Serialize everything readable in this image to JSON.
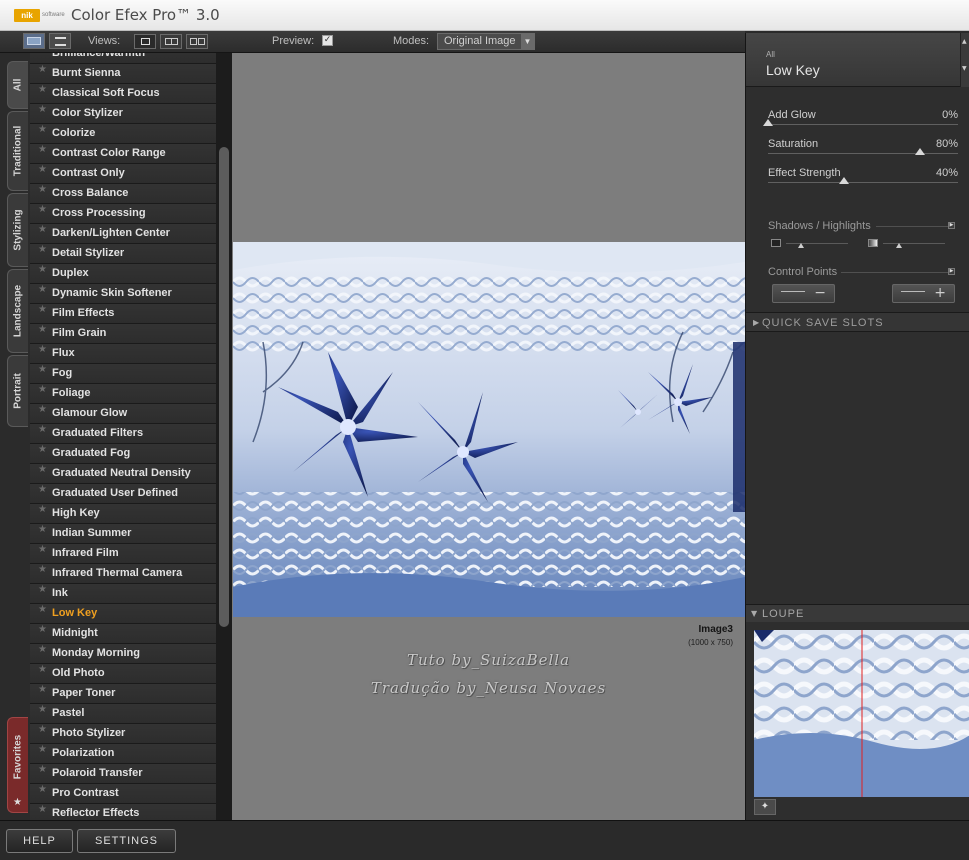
{
  "window": {
    "title": "Color Efex Pro™ 3.0",
    "logo_badge": "nik",
    "logo_sub": "software"
  },
  "toolbar": {
    "views_label": "Views:",
    "preview_label": "Preview:",
    "preview_checked": "✓",
    "modes_label": "Modes:",
    "mode_value": "Original Image"
  },
  "tabs": [
    {
      "label": "All"
    },
    {
      "label": "Traditional"
    },
    {
      "label": "Stylizing"
    },
    {
      "label": "Landscape"
    },
    {
      "label": "Portrait"
    },
    {
      "label": "Favorites"
    }
  ],
  "filters": {
    "selected": "Low Key",
    "items": [
      "Brilliance/Warmth",
      "Burnt Sienna",
      "Classical Soft Focus",
      "Color Stylizer",
      "Colorize",
      "Contrast Color Range",
      "Contrast Only",
      "Cross Balance",
      "Cross Processing",
      "Darken/Lighten Center",
      "Detail Stylizer",
      "Duplex",
      "Dynamic Skin Softener",
      "Film Effects",
      "Film Grain",
      "Flux",
      "Fog",
      "Foliage",
      "Glamour Glow",
      "Graduated Filters",
      "Graduated Fog",
      "Graduated Neutral Density",
      "Graduated User Defined",
      "High Key",
      "Indian Summer",
      "Infrared Film",
      "Infrared Thermal Camera",
      "Ink",
      "Low Key",
      "Midnight",
      "Monday Morning",
      "Old Photo",
      "Paper Toner",
      "Pastel",
      "Photo Stylizer",
      "Polarization",
      "Polaroid Transfer",
      "Pro Contrast",
      "Reflector Effects"
    ]
  },
  "canvas": {
    "image_name": "Image3",
    "image_size": "(1000 x 750)",
    "watermark_line1": "Tuto by_SuizaBella",
    "watermark_line2": "Tradução by_Neusa Novaes"
  },
  "panel": {
    "category": "All",
    "filter_name": "Low Key",
    "sliders": [
      {
        "label": "Add Glow",
        "value": "0%",
        "level": 0.0
      },
      {
        "label": "Saturation",
        "value": "80%",
        "level": 0.8
      },
      {
        "label": "Effect Strength",
        "value": "40%",
        "level": 0.4
      }
    ],
    "shadows_highlights_label": "Shadows / Highlights",
    "control_points_label": "Control Points",
    "quick_save_label": "QUICK SAVE SLOTS",
    "loupe_label": "LOUPE"
  },
  "bottom": {
    "help_label": "HELP",
    "settings_label": "SETTINGS"
  },
  "colors": {
    "selected_filter": "#f0a020",
    "favorites_tab": "#7a2a2a",
    "loupe_guide": "#e02020"
  }
}
